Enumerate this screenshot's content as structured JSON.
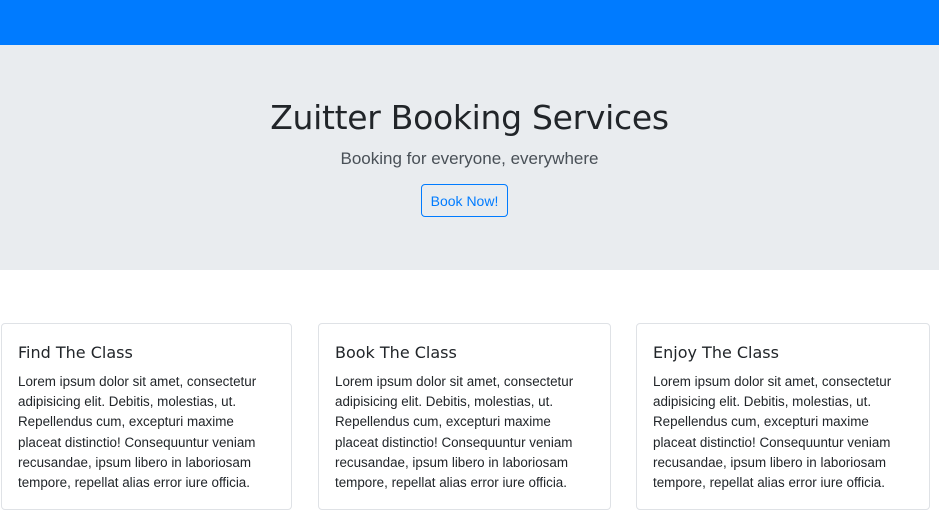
{
  "colors": {
    "navbar": "#007bff",
    "jumbotron": "#e9ecef",
    "accent": "#007bff"
  },
  "hero": {
    "title": "Zuitter Booking Services",
    "subtitle": "Booking for everyone, everywhere",
    "cta_label": "Book Now!"
  },
  "cards": [
    {
      "title": "Find The Class",
      "text": "Lorem ipsum dolor sit amet, consectetur adipisicing elit. Debitis, molestias, ut. Repellendus cum, excepturi maxime placeat distinctio! Consequuntur veniam recusandae, ipsum libero in laboriosam tempore, repellat alias error iure officia."
    },
    {
      "title": "Book The Class",
      "text": "Lorem ipsum dolor sit amet, consectetur adipisicing elit. Debitis, molestias, ut. Repellendus cum, excepturi maxime placeat distinctio! Consequuntur veniam recusandae, ipsum libero in laboriosam tempore, repellat alias error iure officia."
    },
    {
      "title": "Enjoy The Class",
      "text": "Lorem ipsum dolor sit amet, consectetur adipisicing elit. Debitis, molestias, ut. Repellendus cum, excepturi maxime placeat distinctio! Consequuntur veniam recusandae, ipsum libero in laboriosam tempore, repellat alias error iure officia."
    }
  ]
}
